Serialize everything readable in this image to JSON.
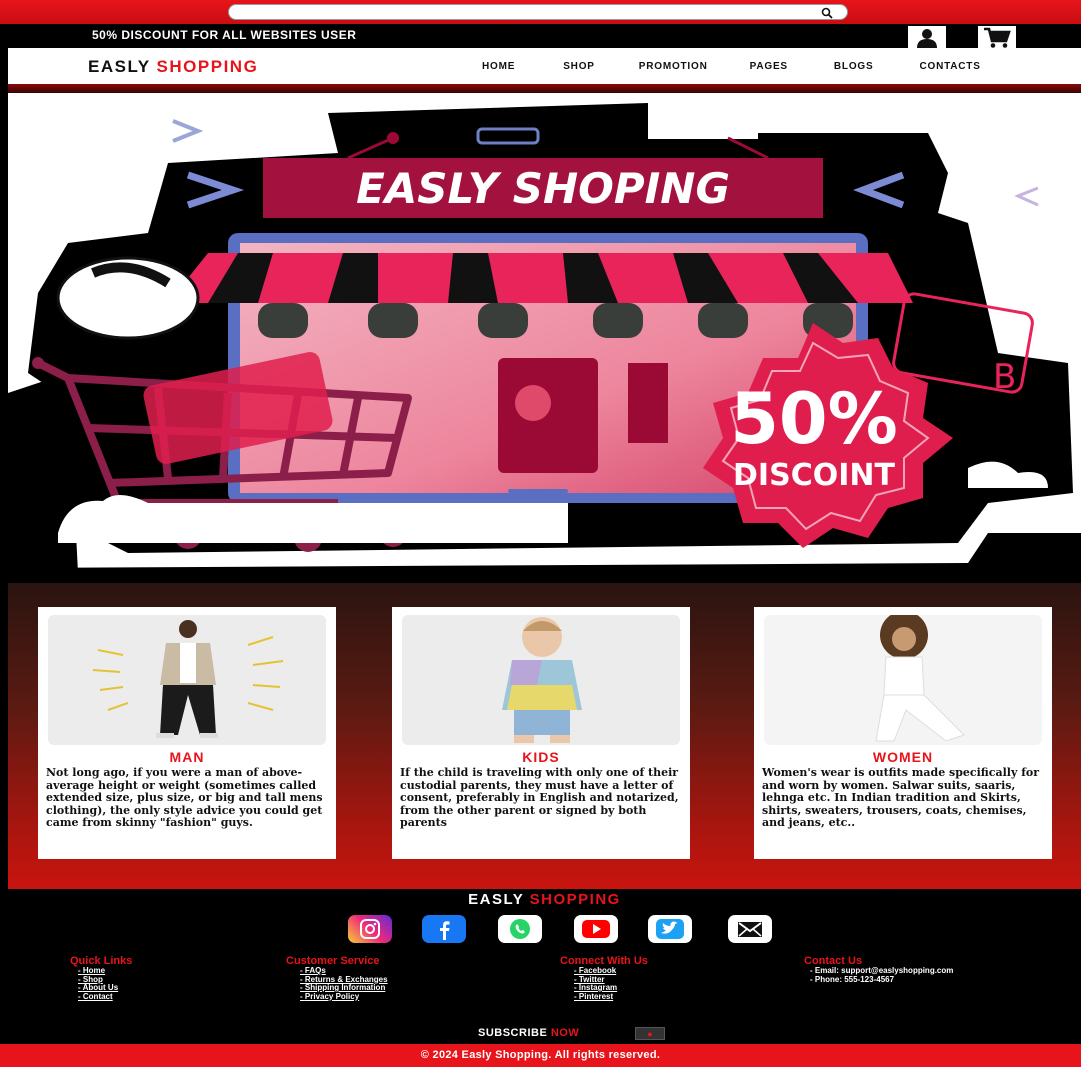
{
  "search": {
    "placeholder": ""
  },
  "strip": {
    "promo_text": "50% DISCOUNT FOR ALL WEBSITES USER"
  },
  "header": {
    "brand_part1": "EASLY",
    "brand_part2": "SHOPPING",
    "menu": [
      "HOME",
      "SHOP",
      "PROMOTION",
      "PAGES",
      "BLOGS",
      "CONTACTS"
    ]
  },
  "hero": {
    "banner_text": "EASLY SHOPING",
    "badge_percent": "50%",
    "badge_label": "DISCOINT"
  },
  "categories": [
    {
      "title": "MAN",
      "text": "Not long ago, if you were a man of above-average height or weight (sometimes called extended size, plus size, or big and tall mens clothing), the only style advice you could get came from skinny \"fashion\" guys."
    },
    {
      "title": "KIDS",
      "text": "If the child is traveling with only one of their custodial parents, they must have a letter of consent, preferably in English and notarized, from the other parent or signed by both parents"
    },
    {
      "title": "WOMEN",
      "text": "Women's wear is outfits made specifically for and worn by women. Salwar suits, saaris, lehnga etc. In Indian tradition and Skirts, shirts, sweaters, trousers, coats, chemises, and jeans, etc.."
    }
  ],
  "footer": {
    "brand_part1": "EASLY",
    "brand_part2": "SHOPPING",
    "social_icons": [
      "instagram-icon",
      "facebook-icon",
      "whatsapp-icon",
      "youtube-icon",
      "twitter-icon",
      "mail-icon"
    ],
    "quick_links": {
      "title": "Quick Links",
      "items": [
        "Home",
        "Shop",
        "About Us",
        "Contact"
      ]
    },
    "customer_service": {
      "title": "Customer Service",
      "items": [
        "FAQs",
        "Returns & Exchanges",
        "Shipping Information",
        "Privacy Policy"
      ]
    },
    "connect": {
      "title": "Connect With Us",
      "items": [
        "Facebook",
        "Twitter",
        "Instagram",
        "Pinterest"
      ]
    },
    "contact": {
      "title": "Contact Us",
      "items": [
        "Email: support@easlyshopping.com",
        "Phone: 555-123-4567"
      ]
    },
    "subscribe_part1": "SUBSCRIBE",
    "subscribe_part2": "NOW",
    "subscribe_button": "●"
  },
  "copyright": "© 2024 Easly Shopping. All rights reserved.",
  "colors": {
    "accent": "#e8141b",
    "dark": "#000000",
    "banner": "#a3123f"
  }
}
